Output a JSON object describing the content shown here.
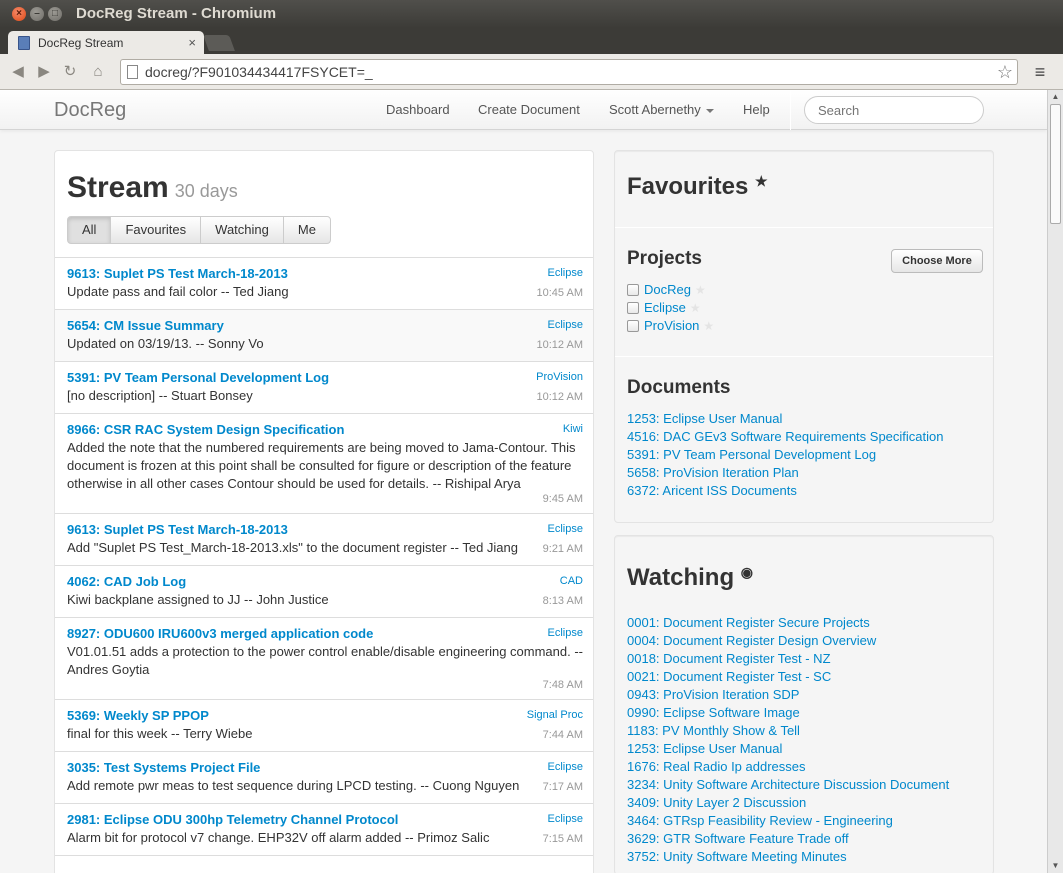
{
  "window": {
    "title": "DocReg Stream - Chromium"
  },
  "tab": {
    "title": "DocReg Stream",
    "close": "×"
  },
  "toolbar": {
    "url": "docreg/?F901034434417FSYCET=_"
  },
  "nav": {
    "brand": "DocReg",
    "links": [
      "Dashboard",
      "Create Document",
      "Scott Abernethy",
      "Help"
    ],
    "search_placeholder": "Search"
  },
  "stream": {
    "title": "Stream",
    "subtitle": "30 days",
    "filters": [
      "All",
      "Favourites",
      "Watching",
      "Me"
    ],
    "active_filter": "All",
    "items": [
      {
        "title": "9613: Suplet PS Test March-18-2013",
        "project": "Eclipse",
        "desc": "Update pass and fail color -- Ted Jiang",
        "time": "10:45 AM"
      },
      {
        "title": "5654: CM Issue Summary",
        "project": "Eclipse",
        "desc": "Updated on 03/19/13. -- Sonny Vo",
        "time": "10:12 AM"
      },
      {
        "title": "5391: PV Team Personal Development Log",
        "project": "ProVision",
        "desc": "[no description] -- Stuart Bonsey",
        "time": "10:12 AM"
      },
      {
        "title": "8966: CSR RAC System Design Specification",
        "project": "Kiwi",
        "desc": "Added the note that the numbered requirements are being moved to Jama-Contour. This document is frozen at this point shall be consulted for figure or description of the feature otherwise in all other cases Contour should be used for details. -- Rishipal Arya",
        "time": "9:45 AM"
      },
      {
        "title": "9613: Suplet PS Test March-18-2013",
        "project": "Eclipse",
        "desc": "Add \"Suplet PS Test_March-18-2013.xls\" to the document register -- Ted Jiang",
        "time": "9:21 AM"
      },
      {
        "title": "4062: CAD Job Log",
        "project": "CAD",
        "desc": "Kiwi backplane assigned to JJ -- John Justice",
        "time": "8:13 AM"
      },
      {
        "title": "8927: ODU600 IRU600v3 merged application code",
        "project": "Eclipse",
        "desc": "V01.01.51 adds a protection to the power control enable/disable engineering command. -- Andres Goytia",
        "time": "7:48 AM"
      },
      {
        "title": "5369: Weekly SP PPOP",
        "project": "Signal Proc",
        "desc": "final for this week -- Terry Wiebe",
        "time": "7:44 AM"
      },
      {
        "title": "3035: Test Systems Project File",
        "project": "Eclipse",
        "desc": "Add remote pwr meas to test sequence during LPCD testing. -- Cuong Nguyen",
        "time": "7:17 AM"
      },
      {
        "title": "2981: Eclipse ODU 300hp Telemetry Channel Protocol",
        "project": "Eclipse",
        "desc": "Alarm bit for protocol v7 change. EHP32V off alarm added -- Primoz Salic",
        "time": "7:15 AM"
      }
    ]
  },
  "favourites": {
    "title": "Favourites",
    "projects_heading": "Projects",
    "choose_more": "Choose More",
    "projects": [
      "DocReg",
      "Eclipse",
      "ProVision"
    ],
    "documents_heading": "Documents",
    "documents": [
      "1253: Eclipse User Manual",
      "4516: DAC GEv3 Software Requirements Specification",
      "5391: PV Team Personal Development Log",
      "5658: ProVision Iteration Plan",
      "6372: Aricent ISS Documents"
    ]
  },
  "watching": {
    "title": "Watching",
    "documents": [
      "0001: Document Register Secure Projects",
      "0004: Document Register Design Overview",
      "0018: Document Register Test - NZ",
      "0021: Document Register Test - SC",
      "0943: ProVision Iteration SDP",
      "0990: Eclipse Software Image",
      "1183: PV Monthly Show & Tell",
      "1253: Eclipse User Manual",
      "1676: Real Radio Ip addresses",
      "3234: Unity Software Architecture Discussion Document",
      "3409: Unity Layer 2 Discussion",
      "3464: GTRsp Feasibility Review - Engineering",
      "3629: GTR Software Feature Trade off",
      "3752: Unity Software Meeting Minutes"
    ]
  },
  "colors": {
    "link": "#0088cc",
    "ubuntu_close": "#dd4814",
    "titlebar": "#3c3b37"
  }
}
